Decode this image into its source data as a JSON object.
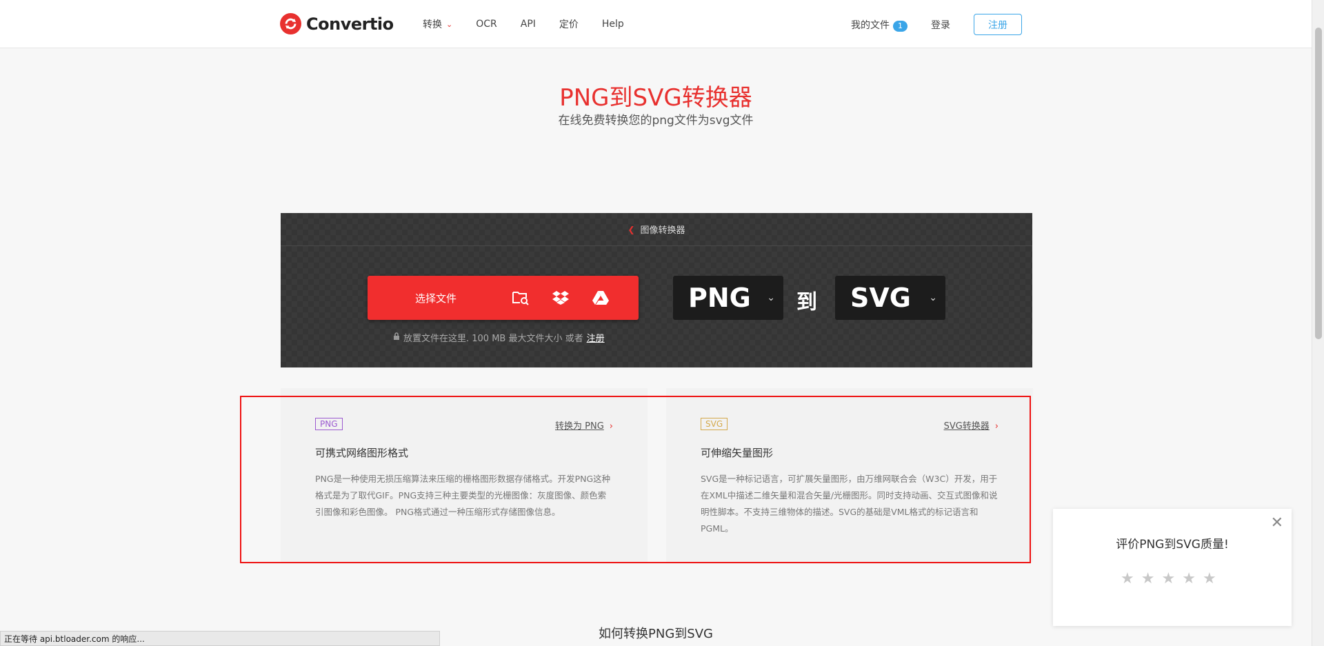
{
  "header": {
    "logo_text": "Convertio",
    "nav": [
      {
        "label": "转换",
        "has_dropdown": true
      },
      {
        "label": "OCR"
      },
      {
        "label": "API"
      },
      {
        "label": "定价"
      },
      {
        "label": "Help"
      }
    ],
    "my_files_label": "我的文件",
    "my_files_count": "1",
    "login_label": "登录",
    "signup_label": "注册"
  },
  "hero": {
    "title": "PNG到SVG转换器",
    "subtitle": "在线免费转换您的png文件为svg文件"
  },
  "converter": {
    "breadcrumb": "图像转换器",
    "choose_label": "选择文件",
    "drop_hint": "放置文件在这里. 100 MB 最大文件大小 或者",
    "drop_hint_link": "注册",
    "from_format": "PNG",
    "to_word": "到",
    "to_format": "SVG"
  },
  "cards": [
    {
      "tag": "PNG",
      "link": "转换为 PNG",
      "title": "可携式网络图形格式",
      "desc": "PNG是一种使用无损压缩算法来压缩的栅格图形数据存储格式。开发PNG这种格式是为了取代GIF。PNG支持三种主要类型的光栅图像：灰度图像、颜色索引图像和彩色图像。 PNG格式通过一种压缩形式存储图像信息。",
      "tag_color": "#9b59d0"
    },
    {
      "tag": "SVG",
      "link": "SVG转换器",
      "title": "可伸缩矢量图形",
      "desc": "SVG是一种标记语言，可扩展矢量图形，由万维网联合会（W3C）开发，用于在XML中描述二维矢量和混合矢量/光栅图形。同时支持动画、交互式图像和说明性脚本。不支持三维物体的描述。SVG的基础是VML格式的标记语言和PGML。",
      "tag_color": "#d4a94a"
    }
  ],
  "rate": {
    "title": "评价PNG到SVG质量!",
    "stars": 5
  },
  "howto_title": "如何转换PNG到SVG",
  "status_bar": "正在等待 api.btloader.com 的响应...",
  "colors": {
    "brand_red": "#e8312f",
    "accent_blue": "#3aa5e8"
  }
}
